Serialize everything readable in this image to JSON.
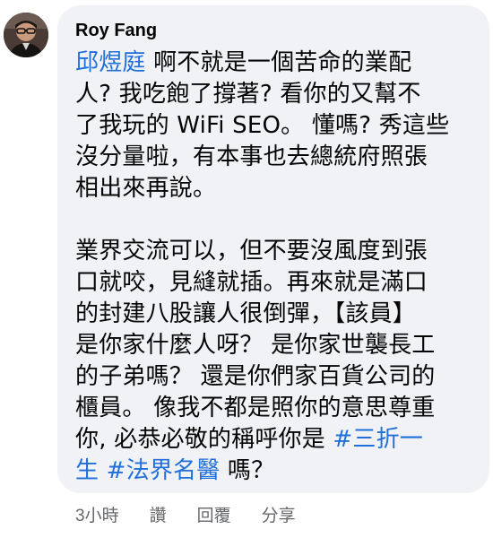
{
  "comment": {
    "author": "Roy Fang",
    "avatar_icon": "profile-photo-icon",
    "lines": [
      [
        {
          "t": "邱煜庭",
          "mention": true
        },
        {
          "t": " 啊不就是一個苦命的業配"
        }
      ],
      [
        {
          "t": "人? 我吃飽了撐著? 看你的又幫不"
        }
      ],
      [
        {
          "t": "了我玩的 WiFi SEO。 懂嗎? 秀這些"
        }
      ],
      [
        {
          "t": "沒分量啦，有本事也去總統府照張"
        }
      ],
      [
        {
          "t": "相出來再說。"
        }
      ],
      [],
      [
        {
          "t": "業界交流可以，但不要沒風度到張"
        }
      ],
      [
        {
          "t": "口就咬，見縫就插。再來就是滿口"
        }
      ],
      [
        {
          "t": "的封建八股讓人很倒彈，【該員】"
        }
      ],
      [
        {
          "t": "是你家什麼人呀？ 是你家世襲長工"
        }
      ],
      [
        {
          "t": "的子弟嗎？ 還是你們家百貨公司的"
        }
      ],
      [
        {
          "t": "櫃員。 像我不都是照你的意思尊重"
        }
      ],
      [
        {
          "t": "你, 必恭必敬的稱呼你是 "
        },
        {
          "t": "#三折一",
          "mention": true
        }
      ],
      [
        {
          "t": "生",
          "mention": true
        },
        {
          "t": " "
        },
        {
          "t": "#法界名醫",
          "mention": true
        },
        {
          "t": " 嗎？"
        }
      ]
    ]
  },
  "actions": {
    "timestamp": "3小時",
    "like": "讚",
    "reply": "回覆",
    "share": "分享"
  },
  "colors": {
    "bubble_bg": "#f0f2f5",
    "link": "#216fdb",
    "meta_text": "#65676b",
    "body_text": "#050505"
  }
}
